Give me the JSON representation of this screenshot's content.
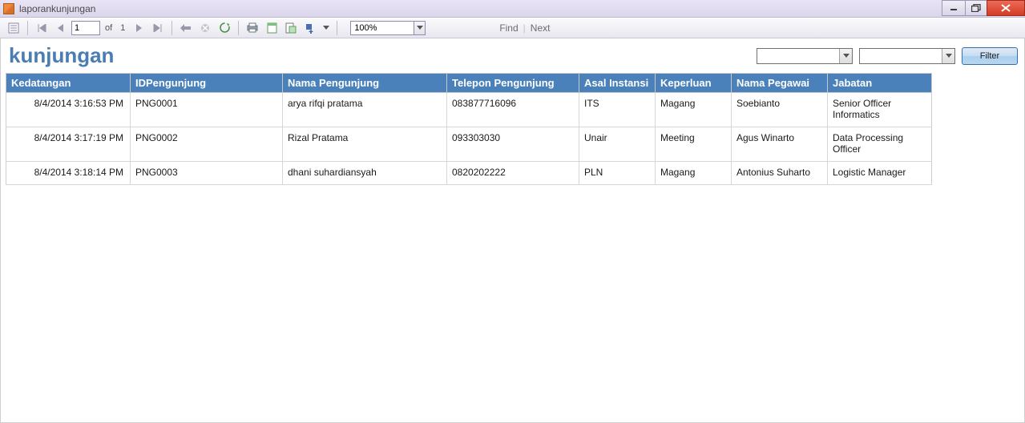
{
  "window": {
    "title": "laporankunjungan"
  },
  "toolbar": {
    "page_current": "1",
    "page_of_label": "of",
    "page_total": "1",
    "zoom": "100%",
    "find_label": "Find",
    "next_label": "Next"
  },
  "report": {
    "title": "kunjungan",
    "filter_combo1": "",
    "filter_combo2": "",
    "filter_button": "Filter",
    "columns": {
      "kedatangan": "Kedatangan",
      "idpengunjung": "IDPengunjung",
      "nama_pengunjung": "Nama Pengunjung",
      "telepon": "Telepon Pengunjung",
      "asal": "Asal Instansi",
      "keperluan": "Keperluan",
      "nama_pegawai": "Nama Pegawai",
      "jabatan": "Jabatan"
    },
    "rows": [
      {
        "kedatangan": "8/4/2014 3:16:53 PM",
        "id": "PNG0001",
        "nama": "arya rifqi pratama",
        "telepon": "083877716096",
        "asal": "ITS",
        "keperluan": "Magang",
        "pegawai": "Soebianto",
        "jabatan": "Senior Officer Informatics"
      },
      {
        "kedatangan": "8/4/2014 3:17:19 PM",
        "id": "PNG0002",
        "nama": "Rizal Pratama",
        "telepon": "093303030",
        "asal": "Unair",
        "keperluan": "Meeting",
        "pegawai": "Agus Winarto",
        "jabatan": "Data Processing Officer"
      },
      {
        "kedatangan": "8/4/2014 3:18:14 PM",
        "id": "PNG0003",
        "nama": "dhani suhardiansyah",
        "telepon": "0820202222",
        "asal": "PLN",
        "keperluan": "Magang",
        "pegawai": "Antonius Suharto",
        "jabatan": "Logistic Manager"
      }
    ]
  }
}
